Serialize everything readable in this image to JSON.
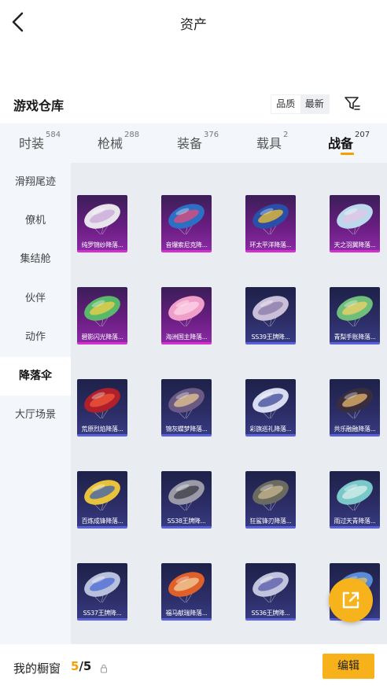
{
  "header": {
    "title": "资产"
  },
  "warehouse": {
    "title": "游戏仓库",
    "sort_options": [
      "品质",
      "最新"
    ],
    "active_sort": 1
  },
  "tabs": [
    {
      "label": "时装",
      "count": "584"
    },
    {
      "label": "枪械",
      "count": "288"
    },
    {
      "label": "装备",
      "count": "376"
    },
    {
      "label": "载具",
      "count": "2"
    },
    {
      "label": "战备",
      "count": "207"
    }
  ],
  "active_tab": 4,
  "sidebar": {
    "items": [
      "滑翔尾迹",
      "僚机",
      "集结舱",
      "伙伴",
      "动作",
      "降落伞",
      "大厅场景"
    ],
    "active": 5
  },
  "items": [
    {
      "name": "纯罗锦纱降落...",
      "rarity": "purple",
      "color": "#e8e4ec",
      "accent": "#c9a8d8"
    },
    {
      "name": "音爆索尼克降...",
      "rarity": "purple",
      "color": "#2d6fc4",
      "accent": "#e84a7a"
    },
    {
      "name": "环太平洋降落...",
      "rarity": "purple",
      "color": "#2a4fa8",
      "accent": "#f2c22e"
    },
    {
      "name": "天之羽翼降落...",
      "rarity": "purple",
      "color": "#bcd8ec",
      "accent": "#e3c6e6"
    },
    {
      "name": "碧影闪光降落...",
      "rarity": "purple",
      "color": "#59b86a",
      "accent": "#f2d14a"
    },
    {
      "name": "海洲国主降落...",
      "rarity": "purple",
      "color": "#f0a0c8",
      "accent": "#ffd6ea"
    },
    {
      "name": "SS39王牌降...",
      "rarity": "blue",
      "color": "#c9bfd8",
      "accent": "#8a7aa8"
    },
    {
      "name": "青梨手账降落...",
      "rarity": "blue",
      "color": "#6fbf7a",
      "accent": "#f2d36a"
    },
    {
      "name": "荒原烈焰降落...",
      "rarity": "blue",
      "color": "#b0202a",
      "accent": "#f25a3a"
    },
    {
      "name": "锦灰蝶梦降落...",
      "rarity": "blue",
      "color": "#6a5a84",
      "accent": "#e8c890"
    },
    {
      "name": "彩旗巡礼降落...",
      "rarity": "blue",
      "color": "#d8dcf0",
      "accent": "#3d4a9a"
    },
    {
      "name": "共乐融融降落...",
      "rarity": "blue",
      "color": "#3a2e3e",
      "accent": "#e8b86a"
    },
    {
      "name": "百炼成锋降落...",
      "rarity": "blue",
      "color": "#e8c23a",
      "accent": "#3a5fb0"
    },
    {
      "name": "SS38王牌降...",
      "rarity": "blue",
      "color": "#9a9aa8",
      "accent": "#3a3a44"
    },
    {
      "name": "狂鲨锋刃降落...",
      "rarity": "blue",
      "color": "#6a6a60",
      "accent": "#c8b890"
    },
    {
      "name": "雨过天青降落...",
      "rarity": "blue",
      "color": "#7ac8c8",
      "accent": "#d8f0ec"
    },
    {
      "name": "SS37王牌降...",
      "rarity": "blue",
      "color": "#b8c0dc",
      "accent": "#4a6ad8"
    },
    {
      "name": "福马献瑞降落...",
      "rarity": "blue",
      "color": "#e0602a",
      "accent": "#f2d0a0"
    },
    {
      "name": "SS36王牌降...",
      "rarity": "blue",
      "color": "#c0c4dc",
      "accent": "#5a5aa8"
    },
    {
      "name": "",
      "rarity": "blue",
      "color": "#5a8ad8",
      "accent": "#e8c85a"
    }
  ],
  "showcase": {
    "label": "我的橱窗",
    "current": "5",
    "total": "/5"
  },
  "edit_label": "编辑",
  "icons": {
    "back": "back-arrow-icon",
    "filter": "filter-icon",
    "lock": "lock-icon",
    "share": "share-icon"
  },
  "colors": {
    "accent": "#f5a000",
    "button": "#f7b11b"
  }
}
